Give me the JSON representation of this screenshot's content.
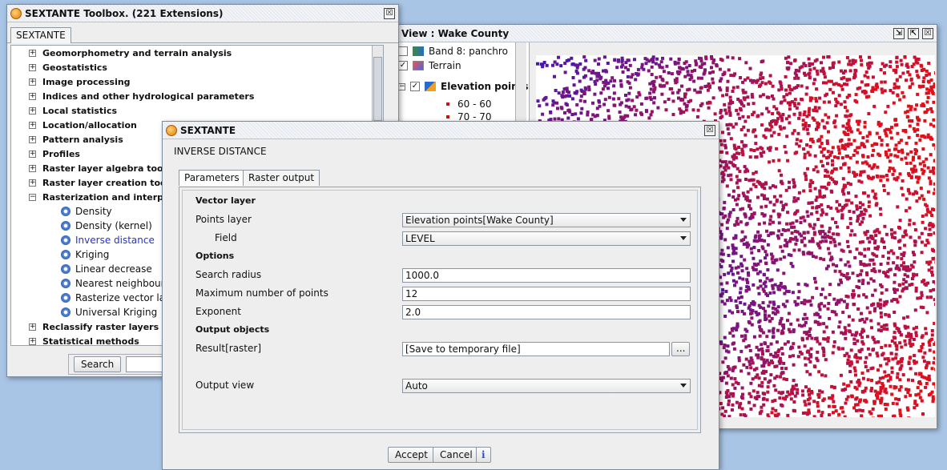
{
  "toolbox": {
    "title": "SEXTANTE Toolbox. (221 Extensions)",
    "tab": "SEXTANTE",
    "close_glyph": "☒",
    "groups_before": [
      "Geomorphometry and terrain analysis",
      "Geostatistics",
      "Image processing",
      "Indices and other hydrological parameters",
      "Local statistics",
      "Location/allocation",
      "Pattern analysis",
      "Profiles",
      "Raster layer algebra tools",
      "Raster layer creation tools"
    ],
    "expanded_group": "Rasterization and interpolation",
    "leaves": [
      "Density",
      "Density (kernel)",
      "Inverse distance",
      "Kriging",
      "Linear decrease",
      "Nearest neighbour",
      "Rasterize vector layer",
      "Universal Kriging"
    ],
    "selected_leaf_index": 2,
    "groups_after": [
      "Reclassify raster layers",
      "Statistical methods"
    ],
    "search_button": "Search",
    "plus_glyph": "+",
    "minus_glyph": "−"
  },
  "view": {
    "title": "View : Wake County",
    "layers": [
      {
        "label": "Band 8: panchro",
        "checked": false
      },
      {
        "label": "Terrain",
        "checked": true
      },
      {
        "label": "Elevation points",
        "checked": true
      }
    ],
    "legend": [
      "60 - 60",
      "70 - 70"
    ],
    "check_glyph": "✓",
    "colors": {
      "low": "#1a1adc",
      "high": "#e0101a"
    }
  },
  "dialog": {
    "title": "SEXTANTE",
    "heading": "INVERSE DISTANCE",
    "tabs": [
      "Parameters",
      "Raster output"
    ],
    "sections": {
      "vector": "Vector layer",
      "options": "Options",
      "output": "Output objects"
    },
    "fields": {
      "points_layer_label": "Points layer",
      "points_layer_value": "Elevation points[Wake County]",
      "field_label": "Field",
      "field_value": "LEVEL",
      "search_radius_label": "Search radius",
      "search_radius_value": "1000.0",
      "max_points_label": "Maximum number of points",
      "max_points_value": "12",
      "exponent_label": "Exponent",
      "exponent_value": "2.0",
      "result_label": "Result[raster]",
      "result_value": "[Save to temporary file]",
      "browse": "...",
      "output_view_label": "Output view",
      "output_view_value": "Auto"
    },
    "buttons": {
      "accept": "Accept",
      "cancel": "Cancel",
      "info": "i"
    },
    "close_glyph": "☒"
  }
}
